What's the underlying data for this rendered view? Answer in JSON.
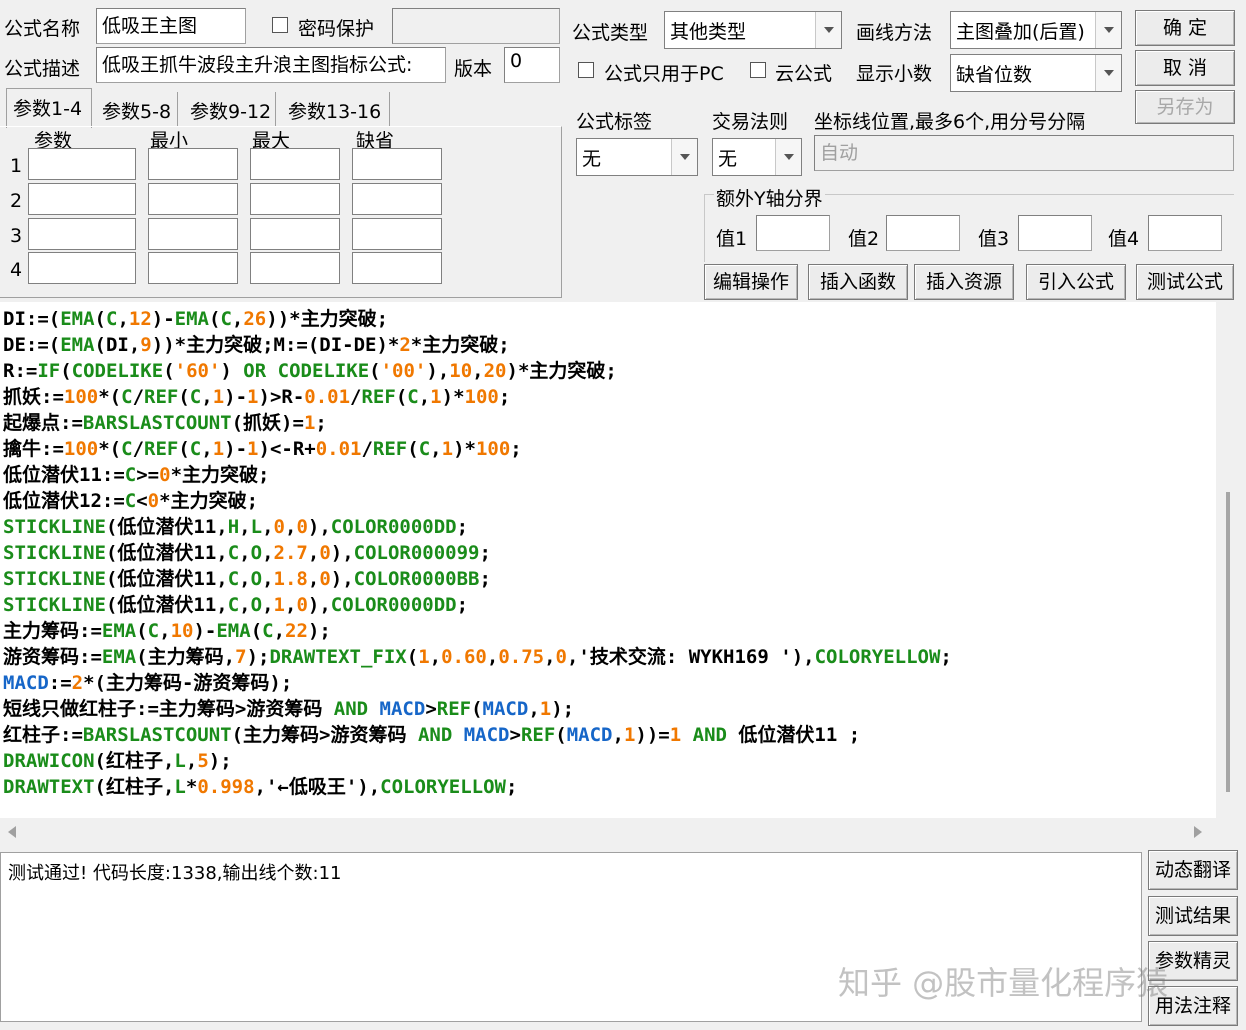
{
  "header": {
    "name_label": "公式名称",
    "name_value": "低吸王主图",
    "password_label": "密码保护",
    "desc_label": "公式描述",
    "desc_value": "低吸王抓牛波段主升浪主图指标公式:",
    "version_label": "版本",
    "version_value": "0",
    "type_label": "公式类型",
    "type_value": "其他类型",
    "draw_label": "画线方法",
    "draw_value": "主图叠加(后置)",
    "pc_only_label": "公式只用于PC",
    "cloud_label": "云公式",
    "decimals_label": "显示小数",
    "decimals_value": "缺省位数",
    "ok_button": "确  定",
    "cancel_button": "取  消",
    "saveas_button": "另存为"
  },
  "params": {
    "tabs": [
      "参数1-4",
      "参数5-8",
      "参数9-12",
      "参数13-16"
    ],
    "columns": [
      "参数",
      "最小",
      "最大",
      "缺省"
    ],
    "rows": [
      "1",
      "2",
      "3",
      "4"
    ]
  },
  "options": {
    "tag_label": "公式标签",
    "tag_value": "无",
    "trade_label": "交易法则",
    "trade_value": "无",
    "axis_label": "坐标线位置,最多6个,用分号分隔",
    "axis_value": "自动",
    "extra_y_label": "额外Y轴分界",
    "val_labels": [
      "值1",
      "值2",
      "值3",
      "值4"
    ]
  },
  "toolbar": [
    "编辑操作",
    "插入函数",
    "插入资源",
    "引入公式",
    "测试公式"
  ],
  "code_lines": [
    [
      [
        "b",
        "DI:=("
      ],
      [
        "k",
        "EMA"
      ],
      [
        "b",
        "("
      ],
      [
        "k",
        "C"
      ],
      [
        "b",
        ","
      ],
      [
        "n",
        "12"
      ],
      [
        "b",
        ")-"
      ],
      [
        "k",
        "EMA"
      ],
      [
        "b",
        "("
      ],
      [
        "k",
        "C"
      ],
      [
        "b",
        ","
      ],
      [
        "n",
        "26"
      ],
      [
        "b",
        "))*主力突破;"
      ]
    ],
    [
      [
        "b",
        "DE:=("
      ],
      [
        "k",
        "EMA"
      ],
      [
        "b",
        "(DI,"
      ],
      [
        "n",
        "9"
      ],
      [
        "b",
        "))*主力突破;M:=(DI-DE)*"
      ],
      [
        "n",
        "2"
      ],
      [
        "b",
        "*主力突破;"
      ]
    ],
    [
      [
        "b",
        "R:="
      ],
      [
        "k",
        "IF"
      ],
      [
        "b",
        "("
      ],
      [
        "k",
        "CODELIKE"
      ],
      [
        "b",
        "("
      ],
      [
        "n",
        "'60'"
      ],
      [
        "b",
        ") "
      ],
      [
        "k",
        "OR"
      ],
      [
        "b",
        " "
      ],
      [
        "k",
        "CODELIKE"
      ],
      [
        "b",
        "("
      ],
      [
        "n",
        "'00'"
      ],
      [
        "b",
        "),"
      ],
      [
        "n",
        "10"
      ],
      [
        "b",
        ","
      ],
      [
        "n",
        "20"
      ],
      [
        "b",
        ")*主力突破;"
      ]
    ],
    [
      [
        "b",
        "抓妖:="
      ],
      [
        "n",
        "100"
      ],
      [
        "b",
        "*("
      ],
      [
        "k",
        "C"
      ],
      [
        "b",
        "/"
      ],
      [
        "k",
        "REF"
      ],
      [
        "b",
        "("
      ],
      [
        "k",
        "C"
      ],
      [
        "b",
        ","
      ],
      [
        "n",
        "1"
      ],
      [
        "b",
        ")-"
      ],
      [
        "n",
        "1"
      ],
      [
        "b",
        ")>R-"
      ],
      [
        "n",
        "0.01"
      ],
      [
        "b",
        "/"
      ],
      [
        "k",
        "REF"
      ],
      [
        "b",
        "("
      ],
      [
        "k",
        "C"
      ],
      [
        "b",
        ","
      ],
      [
        "n",
        "1"
      ],
      [
        "b",
        ")*"
      ],
      [
        "n",
        "100"
      ],
      [
        "b",
        ";"
      ]
    ],
    [
      [
        "b",
        "起爆点:="
      ],
      [
        "k",
        "BARSLASTCOUNT"
      ],
      [
        "b",
        "(抓妖)="
      ],
      [
        "n",
        "1"
      ],
      [
        "b",
        ";"
      ]
    ],
    [
      [
        "b",
        "擒牛:="
      ],
      [
        "n",
        "100"
      ],
      [
        "b",
        "*("
      ],
      [
        "k",
        "C"
      ],
      [
        "b",
        "/"
      ],
      [
        "k",
        "REF"
      ],
      [
        "b",
        "("
      ],
      [
        "k",
        "C"
      ],
      [
        "b",
        ","
      ],
      [
        "n",
        "1"
      ],
      [
        "b",
        ")-"
      ],
      [
        "n",
        "1"
      ],
      [
        "b",
        ")<-R+"
      ],
      [
        "n",
        "0.01"
      ],
      [
        "b",
        "/"
      ],
      [
        "k",
        "REF"
      ],
      [
        "b",
        "("
      ],
      [
        "k",
        "C"
      ],
      [
        "b",
        ","
      ],
      [
        "n",
        "1"
      ],
      [
        "b",
        ")*"
      ],
      [
        "n",
        "100"
      ],
      [
        "b",
        ";"
      ]
    ],
    [
      [
        "b",
        "低位潜伏11:="
      ],
      [
        "k",
        "C"
      ],
      [
        "b",
        ">="
      ],
      [
        "n",
        "0"
      ],
      [
        "b",
        "*主力突破;"
      ]
    ],
    [
      [
        "b",
        "低位潜伏12:="
      ],
      [
        "k",
        "C"
      ],
      [
        "b",
        "<"
      ],
      [
        "n",
        "0"
      ],
      [
        "b",
        "*主力突破;"
      ]
    ],
    [
      [
        "k",
        "STICKLINE"
      ],
      [
        "b",
        "(低位潜伏11,"
      ],
      [
        "k",
        "H"
      ],
      [
        "b",
        ","
      ],
      [
        "k",
        "L"
      ],
      [
        "b",
        ","
      ],
      [
        "n",
        "0"
      ],
      [
        "b",
        ","
      ],
      [
        "n",
        "0"
      ],
      [
        "b",
        "),"
      ],
      [
        "k",
        "COLOR0000DD"
      ],
      [
        "b",
        ";"
      ]
    ],
    [
      [
        "k",
        "STICKLINE"
      ],
      [
        "b",
        "(低位潜伏11,"
      ],
      [
        "k",
        "C"
      ],
      [
        "b",
        ","
      ],
      [
        "k",
        "O"
      ],
      [
        "b",
        ","
      ],
      [
        "n",
        "2.7"
      ],
      [
        "b",
        ","
      ],
      [
        "n",
        "0"
      ],
      [
        "b",
        "),"
      ],
      [
        "k",
        "COLOR000099"
      ],
      [
        "b",
        ";"
      ]
    ],
    [
      [
        "k",
        "STICKLINE"
      ],
      [
        "b",
        "(低位潜伏11,"
      ],
      [
        "k",
        "C"
      ],
      [
        "b",
        ","
      ],
      [
        "k",
        "O"
      ],
      [
        "b",
        ","
      ],
      [
        "n",
        "1.8"
      ],
      [
        "b",
        ","
      ],
      [
        "n",
        "0"
      ],
      [
        "b",
        "),"
      ],
      [
        "k",
        "COLOR0000BB"
      ],
      [
        "b",
        ";"
      ]
    ],
    [
      [
        "k",
        "STICKLINE"
      ],
      [
        "b",
        "(低位潜伏11,"
      ],
      [
        "k",
        "C"
      ],
      [
        "b",
        ","
      ],
      [
        "k",
        "O"
      ],
      [
        "b",
        ","
      ],
      [
        "n",
        "1"
      ],
      [
        "b",
        ","
      ],
      [
        "n",
        "0"
      ],
      [
        "b",
        "),"
      ],
      [
        "k",
        "COLOR0000DD"
      ],
      [
        "b",
        ";"
      ]
    ],
    [
      [
        "b",
        "主力筹码:="
      ],
      [
        "k",
        "EMA"
      ],
      [
        "b",
        "("
      ],
      [
        "k",
        "C"
      ],
      [
        "b",
        ","
      ],
      [
        "n",
        "10"
      ],
      [
        "b",
        ")-"
      ],
      [
        "k",
        "EMA"
      ],
      [
        "b",
        "("
      ],
      [
        "k",
        "C"
      ],
      [
        "b",
        ","
      ],
      [
        "n",
        "22"
      ],
      [
        "b",
        ");"
      ]
    ],
    [
      [
        "b",
        "游资筹码:="
      ],
      [
        "k",
        "EMA"
      ],
      [
        "b",
        "(主力筹码,"
      ],
      [
        "n",
        "7"
      ],
      [
        "b",
        ");"
      ],
      [
        "k",
        "DRAWTEXT_FIX"
      ],
      [
        "b",
        "("
      ],
      [
        "n",
        "1"
      ],
      [
        "b",
        ","
      ],
      [
        "n",
        "0.60"
      ],
      [
        "b",
        ","
      ],
      [
        "n",
        "0.75"
      ],
      [
        "b",
        ","
      ],
      [
        "n",
        "0"
      ],
      [
        "b",
        ",'技术交流: WYKH169 '),"
      ],
      [
        "k",
        "COLORYELLOW"
      ],
      [
        "b",
        ";"
      ]
    ],
    [
      [
        "m",
        "MACD"
      ],
      [
        "b",
        ":="
      ],
      [
        "n",
        "2"
      ],
      [
        "b",
        "*(主力筹码-游资筹码);"
      ]
    ],
    [
      [
        "b",
        "短线只做红柱子:=主力筹码>游资筹码 "
      ],
      [
        "k",
        "AND"
      ],
      [
        "b",
        " "
      ],
      [
        "m",
        "MACD"
      ],
      [
        "b",
        ">"
      ],
      [
        "k",
        "REF"
      ],
      [
        "b",
        "("
      ],
      [
        "m",
        "MACD"
      ],
      [
        "b",
        ","
      ],
      [
        "n",
        "1"
      ],
      [
        "b",
        ");"
      ]
    ],
    [
      [
        "b",
        "红柱子:="
      ],
      [
        "k",
        "BARSLASTCOUNT"
      ],
      [
        "b",
        "(主力筹码>游资筹码 "
      ],
      [
        "k",
        "AND"
      ],
      [
        "b",
        " "
      ],
      [
        "m",
        "MACD"
      ],
      [
        "b",
        ">"
      ],
      [
        "k",
        "REF"
      ],
      [
        "b",
        "("
      ],
      [
        "m",
        "MACD"
      ],
      [
        "b",
        ","
      ],
      [
        "n",
        "1"
      ],
      [
        "b",
        "))="
      ],
      [
        "n",
        "1"
      ],
      [
        "b",
        " "
      ],
      [
        "k",
        "AND"
      ],
      [
        "b",
        " 低位潜伏11 ;"
      ]
    ],
    [
      [
        "k",
        "DRAWICON"
      ],
      [
        "b",
        "(红柱子,"
      ],
      [
        "k",
        "L"
      ],
      [
        "b",
        ","
      ],
      [
        "n",
        "5"
      ],
      [
        "b",
        ");"
      ]
    ],
    [
      [
        "k",
        "DRAWTEXT"
      ],
      [
        "b",
        "(红柱子,"
      ],
      [
        "k",
        "L"
      ],
      [
        "b",
        "*"
      ],
      [
        "n",
        "0.998"
      ],
      [
        "b",
        ",'←低吸王'),"
      ],
      [
        "k",
        "COLORYELLOW"
      ],
      [
        "b",
        ";"
      ]
    ]
  ],
  "result_text": "测试通过! 代码长度:1338,输出线个数:11",
  "side_buttons": [
    "动态翻译",
    "测试结果",
    "参数精灵",
    "用法注释"
  ],
  "watermark": "知乎 @股市量化程序猿"
}
